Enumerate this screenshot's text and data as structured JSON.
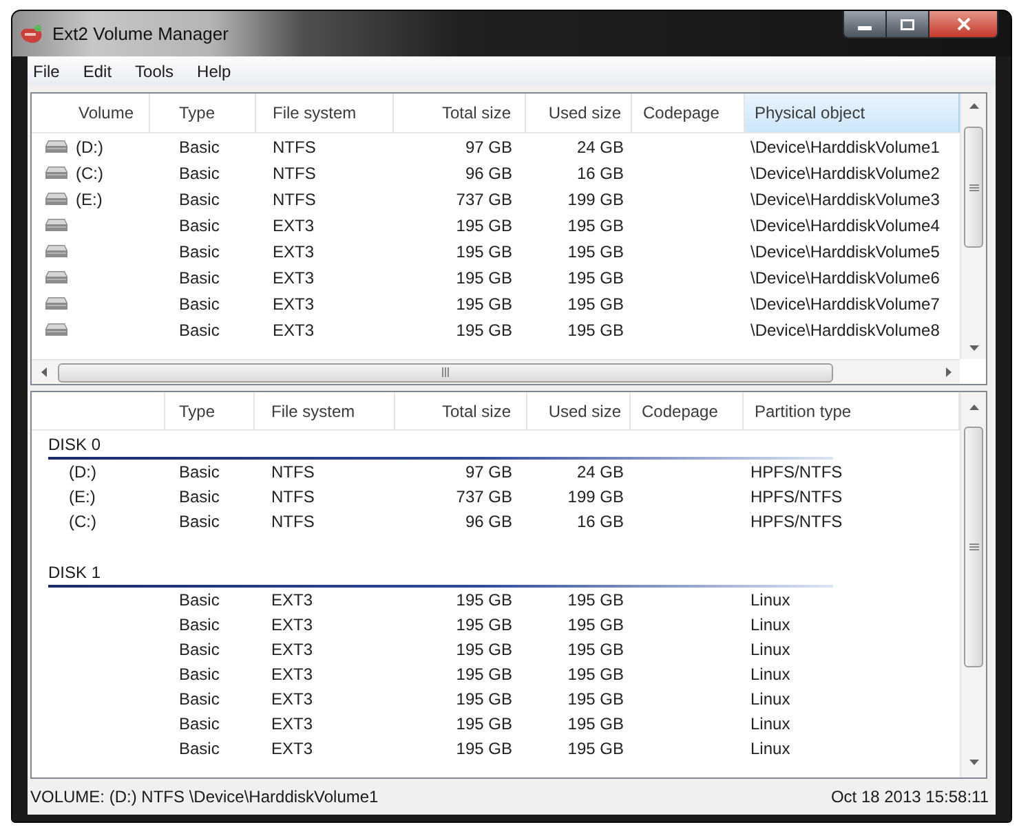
{
  "window": {
    "title": "Ext2 Volume Manager"
  },
  "menu": [
    "File",
    "Edit",
    "Tools",
    "Help"
  ],
  "volume_list": {
    "columns": [
      {
        "label": "Volume",
        "sorted": false
      },
      {
        "label": "Type",
        "sorted": false
      },
      {
        "label": "File system",
        "sorted": false
      },
      {
        "label": "Total size",
        "sorted": false
      },
      {
        "label": "Used size",
        "sorted": false
      },
      {
        "label": "Codepage",
        "sorted": false
      },
      {
        "label": "Physical object",
        "sorted": true
      }
    ],
    "rows": [
      {
        "volume": "(D:)",
        "type": "Basic",
        "file_system": "NTFS",
        "total_size": "97 GB",
        "used_size": "24 GB",
        "physical_object": "\\Device\\HarddiskVolume1"
      },
      {
        "volume": "(C:)",
        "type": "Basic",
        "file_system": "NTFS",
        "total_size": "96 GB",
        "used_size": "16 GB",
        "physical_object": "\\Device\\HarddiskVolume2"
      },
      {
        "volume": "(E:)",
        "type": "Basic",
        "file_system": "NTFS",
        "total_size": "737 GB",
        "used_size": "199 GB",
        "physical_object": "\\Device\\HarddiskVolume3"
      },
      {
        "type": "Basic",
        "file_system": "EXT3",
        "total_size": "195 GB",
        "used_size": "195 GB",
        "physical_object": "\\Device\\HarddiskVolume4"
      },
      {
        "type": "Basic",
        "file_system": "EXT3",
        "total_size": "195 GB",
        "used_size": "195 GB",
        "physical_object": "\\Device\\HarddiskVolume5"
      },
      {
        "type": "Basic",
        "file_system": "EXT3",
        "total_size": "195 GB",
        "used_size": "195 GB",
        "physical_object": "\\Device\\HarddiskVolume6"
      },
      {
        "type": "Basic",
        "file_system": "EXT3",
        "total_size": "195 GB",
        "used_size": "195 GB",
        "physical_object": "\\Device\\HarddiskVolume7"
      },
      {
        "type": "Basic",
        "file_system": "EXT3",
        "total_size": "195 GB",
        "used_size": "195 GB",
        "physical_object": "\\Device\\HarddiskVolume8"
      }
    ]
  },
  "partition_list": {
    "columns": [
      "Type",
      "File system",
      "Total size",
      "Used size",
      "Codepage",
      "Partition type"
    ],
    "disks": [
      {
        "label": "DISK 0",
        "partitions": [
          {
            "volume": "(D:)",
            "type": "Basic",
            "file_system": "NTFS",
            "total_size": "97 GB",
            "used_size": "24 GB",
            "partition_type": "HPFS/NTFS"
          },
          {
            "volume": "(E:)",
            "type": "Basic",
            "file_system": "NTFS",
            "total_size": "737 GB",
            "used_size": "199 GB",
            "partition_type": "HPFS/NTFS"
          },
          {
            "volume": "(C:)",
            "type": "Basic",
            "file_system": "NTFS",
            "total_size": "96 GB",
            "used_size": "16 GB",
            "partition_type": "HPFS/NTFS"
          }
        ]
      },
      {
        "label": "DISK 1",
        "partitions": [
          {
            "type": "Basic",
            "file_system": "EXT3",
            "total_size": "195 GB",
            "used_size": "195 GB",
            "partition_type": "Linux"
          },
          {
            "type": "Basic",
            "file_system": "EXT3",
            "total_size": "195 GB",
            "used_size": "195 GB",
            "partition_type": "Linux"
          },
          {
            "type": "Basic",
            "file_system": "EXT3",
            "total_size": "195 GB",
            "used_size": "195 GB",
            "partition_type": "Linux"
          },
          {
            "type": "Basic",
            "file_system": "EXT3",
            "total_size": "195 GB",
            "used_size": "195 GB",
            "partition_type": "Linux"
          },
          {
            "type": "Basic",
            "file_system": "EXT3",
            "total_size": "195 GB",
            "used_size": "195 GB",
            "partition_type": "Linux"
          },
          {
            "type": "Basic",
            "file_system": "EXT3",
            "total_size": "195 GB",
            "used_size": "195 GB",
            "partition_type": "Linux"
          },
          {
            "type": "Basic",
            "file_system": "EXT3",
            "total_size": "195 GB",
            "used_size": "195 GB",
            "partition_type": "Linux"
          }
        ]
      }
    ]
  },
  "status_bar": {
    "volume_info": "VOLUME: (D:) NTFS \\Device\\HarddiskVolume1",
    "timestamp": "Oct 18 2013 15:58:11"
  }
}
